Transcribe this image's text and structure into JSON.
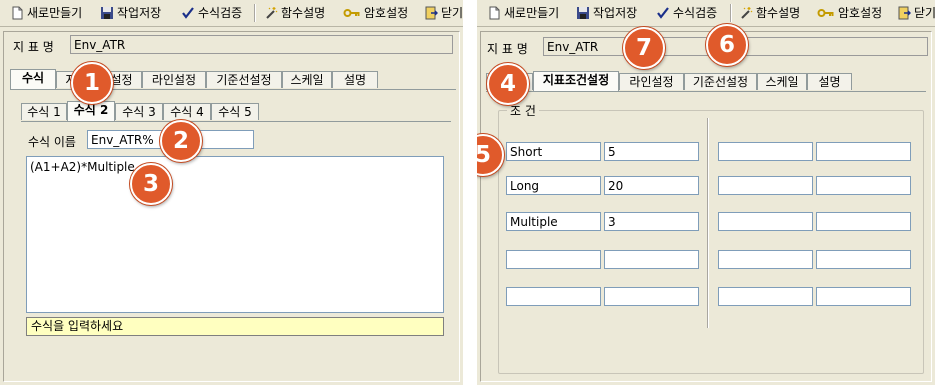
{
  "toolbar": {
    "new": "새로만들기",
    "save": "작업저장",
    "verify": "수식검증",
    "func_desc": "함수설명",
    "password": "암호설정",
    "close_left": "닫기",
    "close_right": "닫기"
  },
  "indicator": {
    "name_label": "지 표 명",
    "name_value": "Env_ATR"
  },
  "main_tabs": {
    "formula": "수식",
    "index_conditions": "지표조건설정",
    "index_conditions_partial": "지",
    "index_conditions_tail": "설정",
    "line_settings": "라인설정",
    "baseline_settings": "기준선설정",
    "scale": "스케일",
    "description": "설명"
  },
  "formula_tabs": [
    "수식 1",
    "수식 2",
    "수식 3",
    "수식 4",
    "수식 5"
  ],
  "formula": {
    "name_label": "수식 이름",
    "name_value": "Env_ATR%",
    "expression": "(A1+A2)*Multiple",
    "hint": "수식을 입력하세요"
  },
  "conditions": {
    "group_title": "조 건",
    "left_rows": [
      {
        "name": "Short",
        "value": "5"
      },
      {
        "name": "Long",
        "value": "20"
      },
      {
        "name": "Multiple",
        "value": "3"
      },
      {
        "name": "",
        "value": ""
      },
      {
        "name": "",
        "value": ""
      }
    ],
    "right_rows": [
      {
        "name": "",
        "value": ""
      },
      {
        "name": "",
        "value": ""
      },
      {
        "name": "",
        "value": ""
      },
      {
        "name": "",
        "value": ""
      },
      {
        "name": "",
        "value": ""
      }
    ]
  },
  "badges": [
    "1",
    "2",
    "3",
    "4",
    "5",
    "6",
    "7"
  ],
  "colors": {
    "badge": "#e05a2b",
    "hint_background": "#ffffc0",
    "panel_background": "#ece9d8"
  }
}
